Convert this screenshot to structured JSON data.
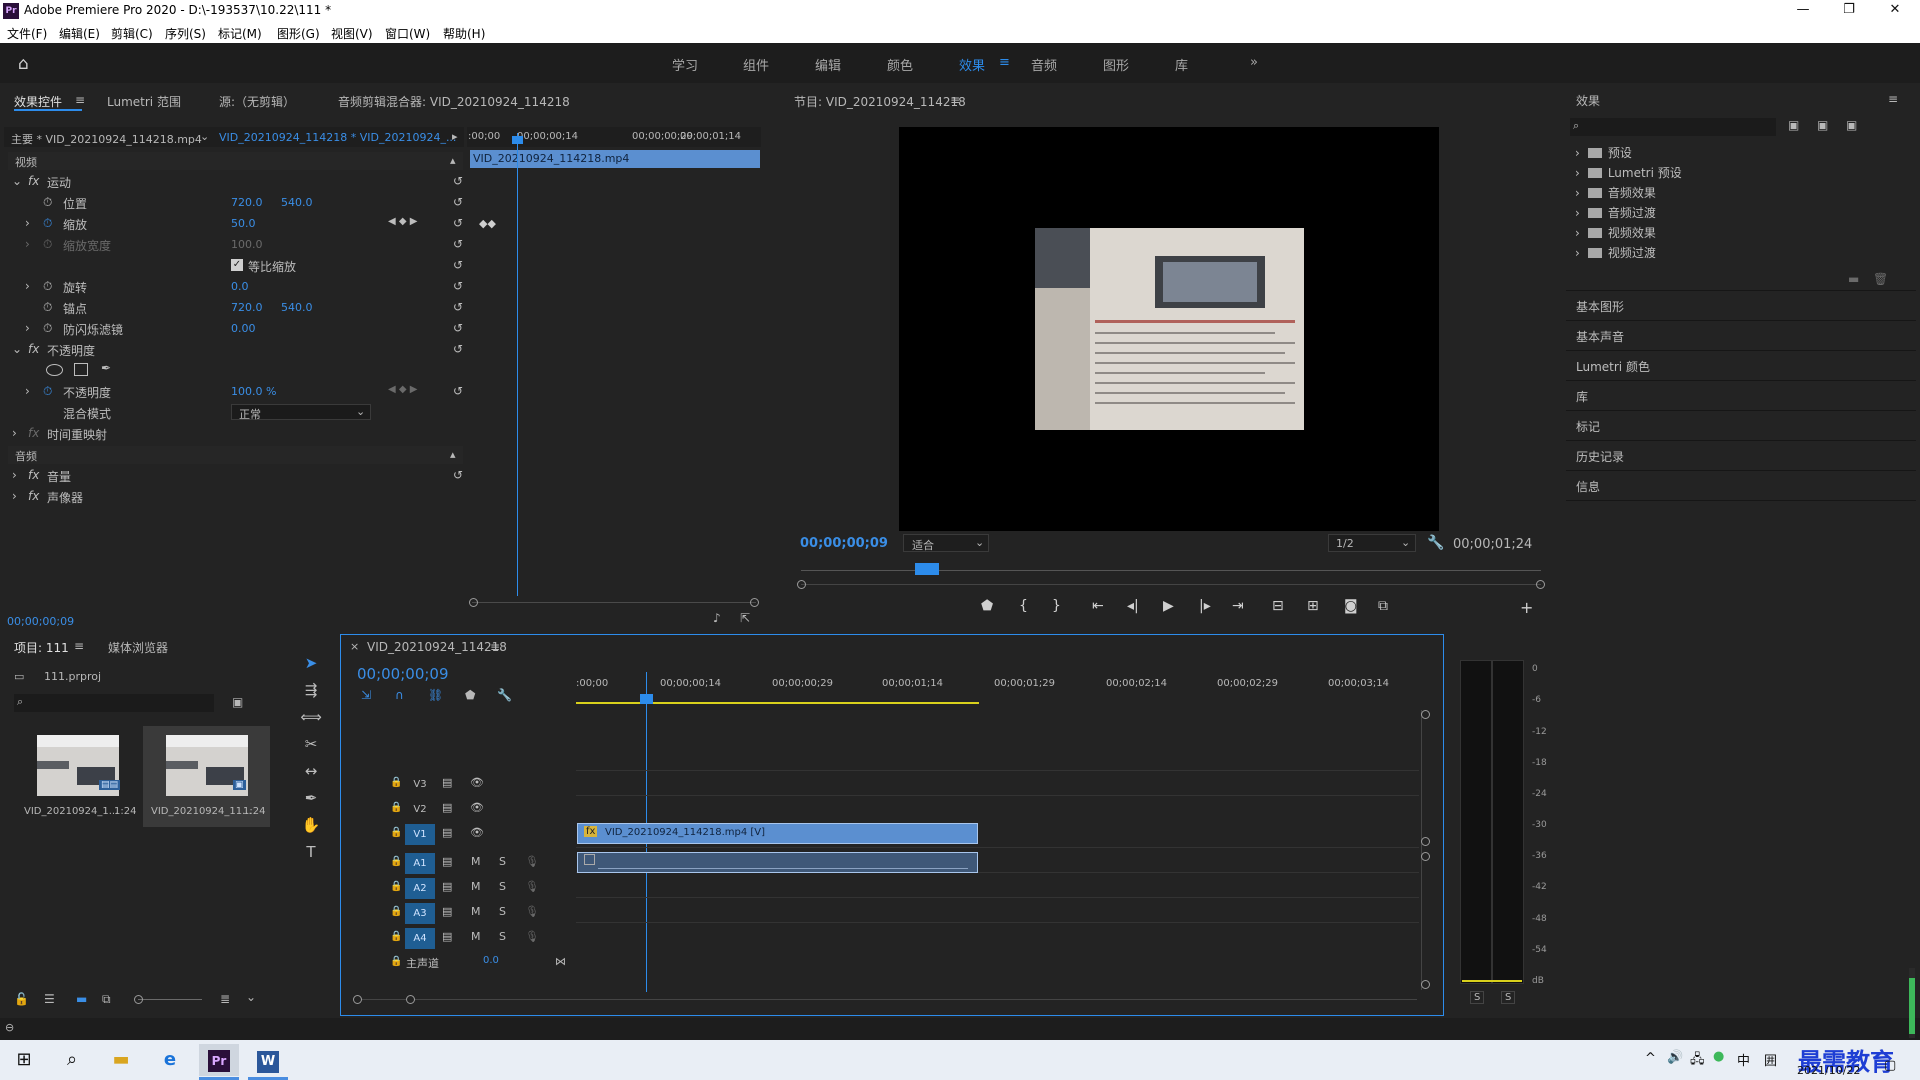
{
  "window": {
    "title": "Adobe Premiere Pro 2020 - D:\\-193537\\10.22\\111 *",
    "app_logo": "Pr",
    "controls": [
      "minimize",
      "maximize",
      "close"
    ]
  },
  "menu": [
    "文件(F)",
    "编辑(E)",
    "剪辑(C)",
    "序列(S)",
    "标记(M)",
    "图形(G)",
    "视图(V)",
    "窗口(W)",
    "帮助(H)"
  ],
  "workspaces": {
    "items": [
      "学习",
      "组件",
      "编辑",
      "颜色",
      "效果",
      "音频",
      "图形",
      "库"
    ],
    "active": "效果",
    "more": "»"
  },
  "effect_controls": {
    "tabs": [
      "效果控件",
      "Lumetri 范围",
      "源:（无剪辑）",
      "音频剪辑混合器: VID_20210924_114218"
    ],
    "master": "主要 * VID_20210924_114218.mp4",
    "sequence_clip": "VID_20210924_114218 * VID_20210924_...",
    "video_header": "视频",
    "audio_header": "音频",
    "ruler": [
      ":00;00",
      "00;00;00;14",
      "00;00;00;29",
      "00;00;01;14"
    ],
    "clip_bar": "VID_20210924_114218.mp4",
    "rows": {
      "motion": "运动",
      "position_label": "位置",
      "position_x": "720.0",
      "position_y": "540.0",
      "scale_label": "缩放",
      "scale_value": "50.0",
      "scale_width_label": "缩放宽度",
      "scale_width_value": "100.0",
      "uniform_scale": "等比缩放",
      "rotation_label": "旋转",
      "rotation_value": "0.0",
      "anchor_label": "锚点",
      "anchor_x": "720.0",
      "anchor_y": "540.0",
      "flicker_label": "防闪烁滤镜",
      "flicker_value": "0.00",
      "opacity_group": "不透明度",
      "opacity_label": "不透明度",
      "opacity_value": "100.0 %",
      "blend_label": "混合模式",
      "blend_value": "正常",
      "time_remap": "时间重映射",
      "volume": "音量",
      "panner": "声像器"
    },
    "timecode": "00;00;00;09"
  },
  "program": {
    "title": "节目: VID_20210924_114218",
    "timecode": "00;00;00;09",
    "fit": "适合",
    "resolution": "1/2",
    "duration": "00;00;01;24",
    "playhead_fraction": 0.17
  },
  "effects_panel": {
    "title": "效果",
    "items": [
      "预设",
      "Lumetri 预设",
      "音频效果",
      "音频过渡",
      "视频效果",
      "视频过渡"
    ],
    "sections": [
      "基本图形",
      "基本声音",
      "Lumetri 颜色",
      "库",
      "标记",
      "历史记录",
      "信息"
    ]
  },
  "project": {
    "tabs": [
      "项目: 111",
      "媒体浏览器"
    ],
    "file": "111.prproj",
    "items": [
      {
        "name": "VID_20210924_1...",
        "duration": "1:24"
      },
      {
        "name": "VID_20210924_11...",
        "duration": "1:24"
      }
    ]
  },
  "timeline": {
    "tab": "VID_20210924_114218",
    "timecode": "00;00;00;09",
    "ruler": [
      ":00;00",
      "00;00;00;14",
      "00;00;00;29",
      "00;00;01;14",
      "00;00;01;29",
      "00;00;02;14",
      "00;00;02;29",
      "00;00;03;14"
    ],
    "video_tracks": [
      "V3",
      "V2",
      "V1"
    ],
    "audio_tracks": [
      "A1",
      "A2",
      "A3",
      "A4"
    ],
    "master": "主声道",
    "master_value": "0.0",
    "video_clip": "VID_20210924_114218.mp4 [V]",
    "track_m": "M",
    "track_s": "S"
  },
  "meter": {
    "labels": [
      "0",
      "-6",
      "-12",
      "-18",
      "-24",
      "-30",
      "-36",
      "-42",
      "-48",
      "-54",
      "dB"
    ],
    "solo": [
      "S",
      "S"
    ]
  },
  "taskbar": {
    "ime": "中",
    "date": "2021/10/22",
    "watermark": "最需教育"
  },
  "colors": {
    "accent": "#2d8ceb",
    "panel": "#232323",
    "clip_video": "#5b8fd0"
  }
}
